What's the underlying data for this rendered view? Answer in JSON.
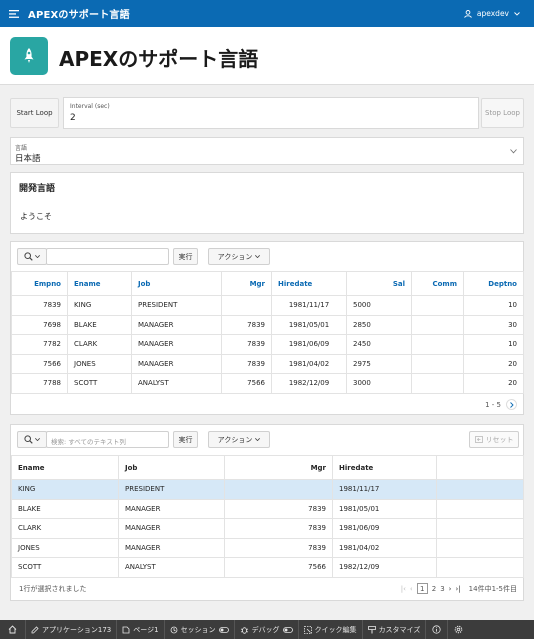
{
  "topbar": {
    "app_name": "APEXのサポート言語",
    "user": "apexdev"
  },
  "header": {
    "page_title": "APEXのサポート言語"
  },
  "loop": {
    "start_label": "Start Loop",
    "interval_label": "Interval (sec)",
    "interval_value": "2",
    "stop_label": "Stop Loop"
  },
  "language": {
    "label": "言語",
    "value": "日本語"
  },
  "dev_region": {
    "title": "開発言語",
    "body": "ようこそ"
  },
  "report1": {
    "search_value": "",
    "go_label": "実行",
    "actions_label": "アクション",
    "columns": [
      "Empno",
      "Ename",
      "Job",
      "Mgr",
      "Hiredate",
      "Sal",
      "Comm",
      "Deptno"
    ],
    "rows": [
      [
        "7839",
        "KING",
        "PRESIDENT",
        "",
        "1981/11/17",
        "5000",
        "",
        "10"
      ],
      [
        "7698",
        "BLAKE",
        "MANAGER",
        "7839",
        "1981/05/01",
        "2850",
        "",
        "30"
      ],
      [
        "7782",
        "CLARK",
        "MANAGER",
        "7839",
        "1981/06/09",
        "2450",
        "",
        "10"
      ],
      [
        "7566",
        "JONES",
        "MANAGER",
        "7839",
        "1981/04/02",
        "2975",
        "",
        "20"
      ],
      [
        "7788",
        "SCOTT",
        "ANALYST",
        "7566",
        "1982/12/09",
        "3000",
        "",
        "20"
      ]
    ],
    "pagination": "1 - 5"
  },
  "report2": {
    "search_placeholder": "検索: すべてのテキスト列",
    "go_label": "実行",
    "actions_label": "アクション",
    "reset_label": "リセット",
    "columns": [
      "Ename",
      "Job",
      "Mgr",
      "Hiredate"
    ],
    "rows": [
      [
        "KING",
        "PRESIDENT",
        "",
        "1981/11/17"
      ],
      [
        "BLAKE",
        "MANAGER",
        "7839",
        "1981/05/01"
      ],
      [
        "CLARK",
        "MANAGER",
        "7839",
        "1981/06/09"
      ],
      [
        "JONES",
        "MANAGER",
        "7839",
        "1981/04/02"
      ],
      [
        "SCOTT",
        "ANALYST",
        "7566",
        "1982/12/09"
      ]
    ],
    "selection_text": "1行が選択されました",
    "pages": [
      "1",
      "2",
      "3"
    ],
    "current_page": "1",
    "range_text": "14件中1-5件目"
  },
  "devbar": {
    "items": [
      "アプリケーション173",
      "ページ1",
      "セッション",
      "デバッグ",
      "クイック編集",
      "カスタマイズ"
    ]
  },
  "colors": {
    "brand": "#0b6ab3",
    "app_icon": "#29a6a3",
    "selected_row": "#d6e8f7",
    "devbar": "#3c3c3c"
  }
}
